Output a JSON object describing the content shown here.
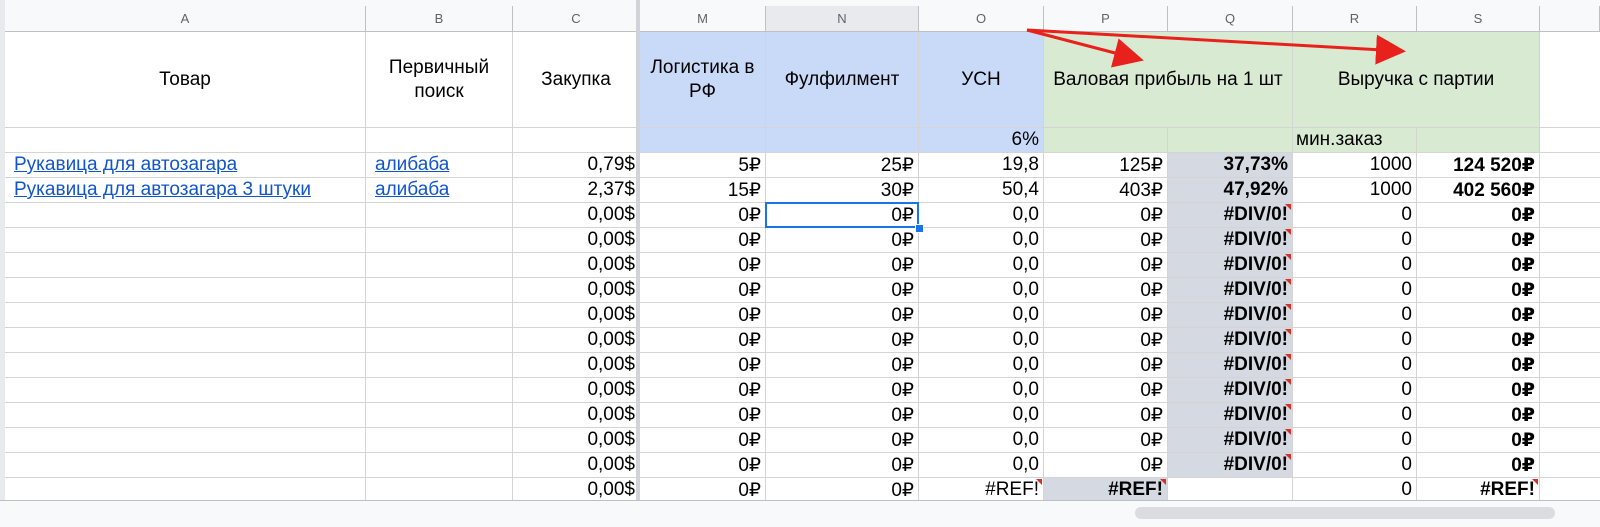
{
  "columns": [
    "A",
    "B",
    "C",
    "M",
    "N",
    "O",
    "P",
    "Q",
    "R",
    "S"
  ],
  "headers": {
    "tovar": "Товар",
    "pervichny": "Первичный поиск",
    "zakupka": "Закупка",
    "logistika": "Логистика в РФ",
    "fulfilment": "Фулфилмент",
    "usn": "УСН",
    "valovaya": "Валовая прибыль на 1 шт",
    "vyruchka": "Выручка с партии"
  },
  "subrow": {
    "usn_rate": "6%",
    "min_order": "мин.заказ"
  },
  "rows": [
    [
      "Рукавица для автозагара",
      "алибаба",
      "0,79$",
      "5₽",
      "25₽",
      "19,8",
      "125₽",
      "37,73%",
      "1000",
      "124 520₽"
    ],
    [
      "Рукавица для автозагара 3 штуки",
      "алибаба",
      "2,37$",
      "15₽",
      "30₽",
      "50,4",
      "403₽",
      "47,92%",
      "1000",
      "402 560₽"
    ],
    [
      "",
      "",
      "0,00$",
      "0₽",
      "0₽",
      "0,0",
      "0₽",
      "#DIV/0!",
      "0",
      "0₽"
    ],
    [
      "",
      "",
      "0,00$",
      "0₽",
      "0₽",
      "0,0",
      "0₽",
      "#DIV/0!",
      "0",
      "0₽"
    ],
    [
      "",
      "",
      "0,00$",
      "0₽",
      "0₽",
      "0,0",
      "0₽",
      "#DIV/0!",
      "0",
      "0₽"
    ],
    [
      "",
      "",
      "0,00$",
      "0₽",
      "0₽",
      "0,0",
      "0₽",
      "#DIV/0!",
      "0",
      "0₽"
    ],
    [
      "",
      "",
      "0,00$",
      "0₽",
      "0₽",
      "0,0",
      "0₽",
      "#DIV/0!",
      "0",
      "0₽"
    ],
    [
      "",
      "",
      "0,00$",
      "0₽",
      "0₽",
      "0,0",
      "0₽",
      "#DIV/0!",
      "0",
      "0₽"
    ],
    [
      "",
      "",
      "0,00$",
      "0₽",
      "0₽",
      "0,0",
      "0₽",
      "#DIV/0!",
      "0",
      "0₽"
    ],
    [
      "",
      "",
      "0,00$",
      "0₽",
      "0₽",
      "0,0",
      "0₽",
      "#DIV/0!",
      "0",
      "0₽"
    ],
    [
      "",
      "",
      "0,00$",
      "0₽",
      "0₽",
      "0,0",
      "0₽",
      "#DIV/0!",
      "0",
      "0₽"
    ],
    [
      "",
      "",
      "0,00$",
      "0₽",
      "0₽",
      "0,0",
      "0₽",
      "#DIV/0!",
      "0",
      "0₽"
    ],
    [
      "",
      "",
      "0,00$",
      "0₽",
      "0₽",
      "0,0",
      "0₽",
      "#DIV/0!",
      "0",
      "0₽"
    ],
    [
      "",
      "",
      "0,00$",
      "0₽",
      "0₽",
      "#REF!",
      "#REF!",
      "",
      "0",
      "#REF!"
    ]
  ],
  "colors": {
    "blue_header": "#c9daf8",
    "green_header": "#d9ead3",
    "error_cell": "#d5dae2",
    "link": "#1155cc",
    "arrow": "#e8211c",
    "selection": "#1a73e8"
  },
  "icons": {
    "error_marker": "red-corner-triangle-icon"
  }
}
